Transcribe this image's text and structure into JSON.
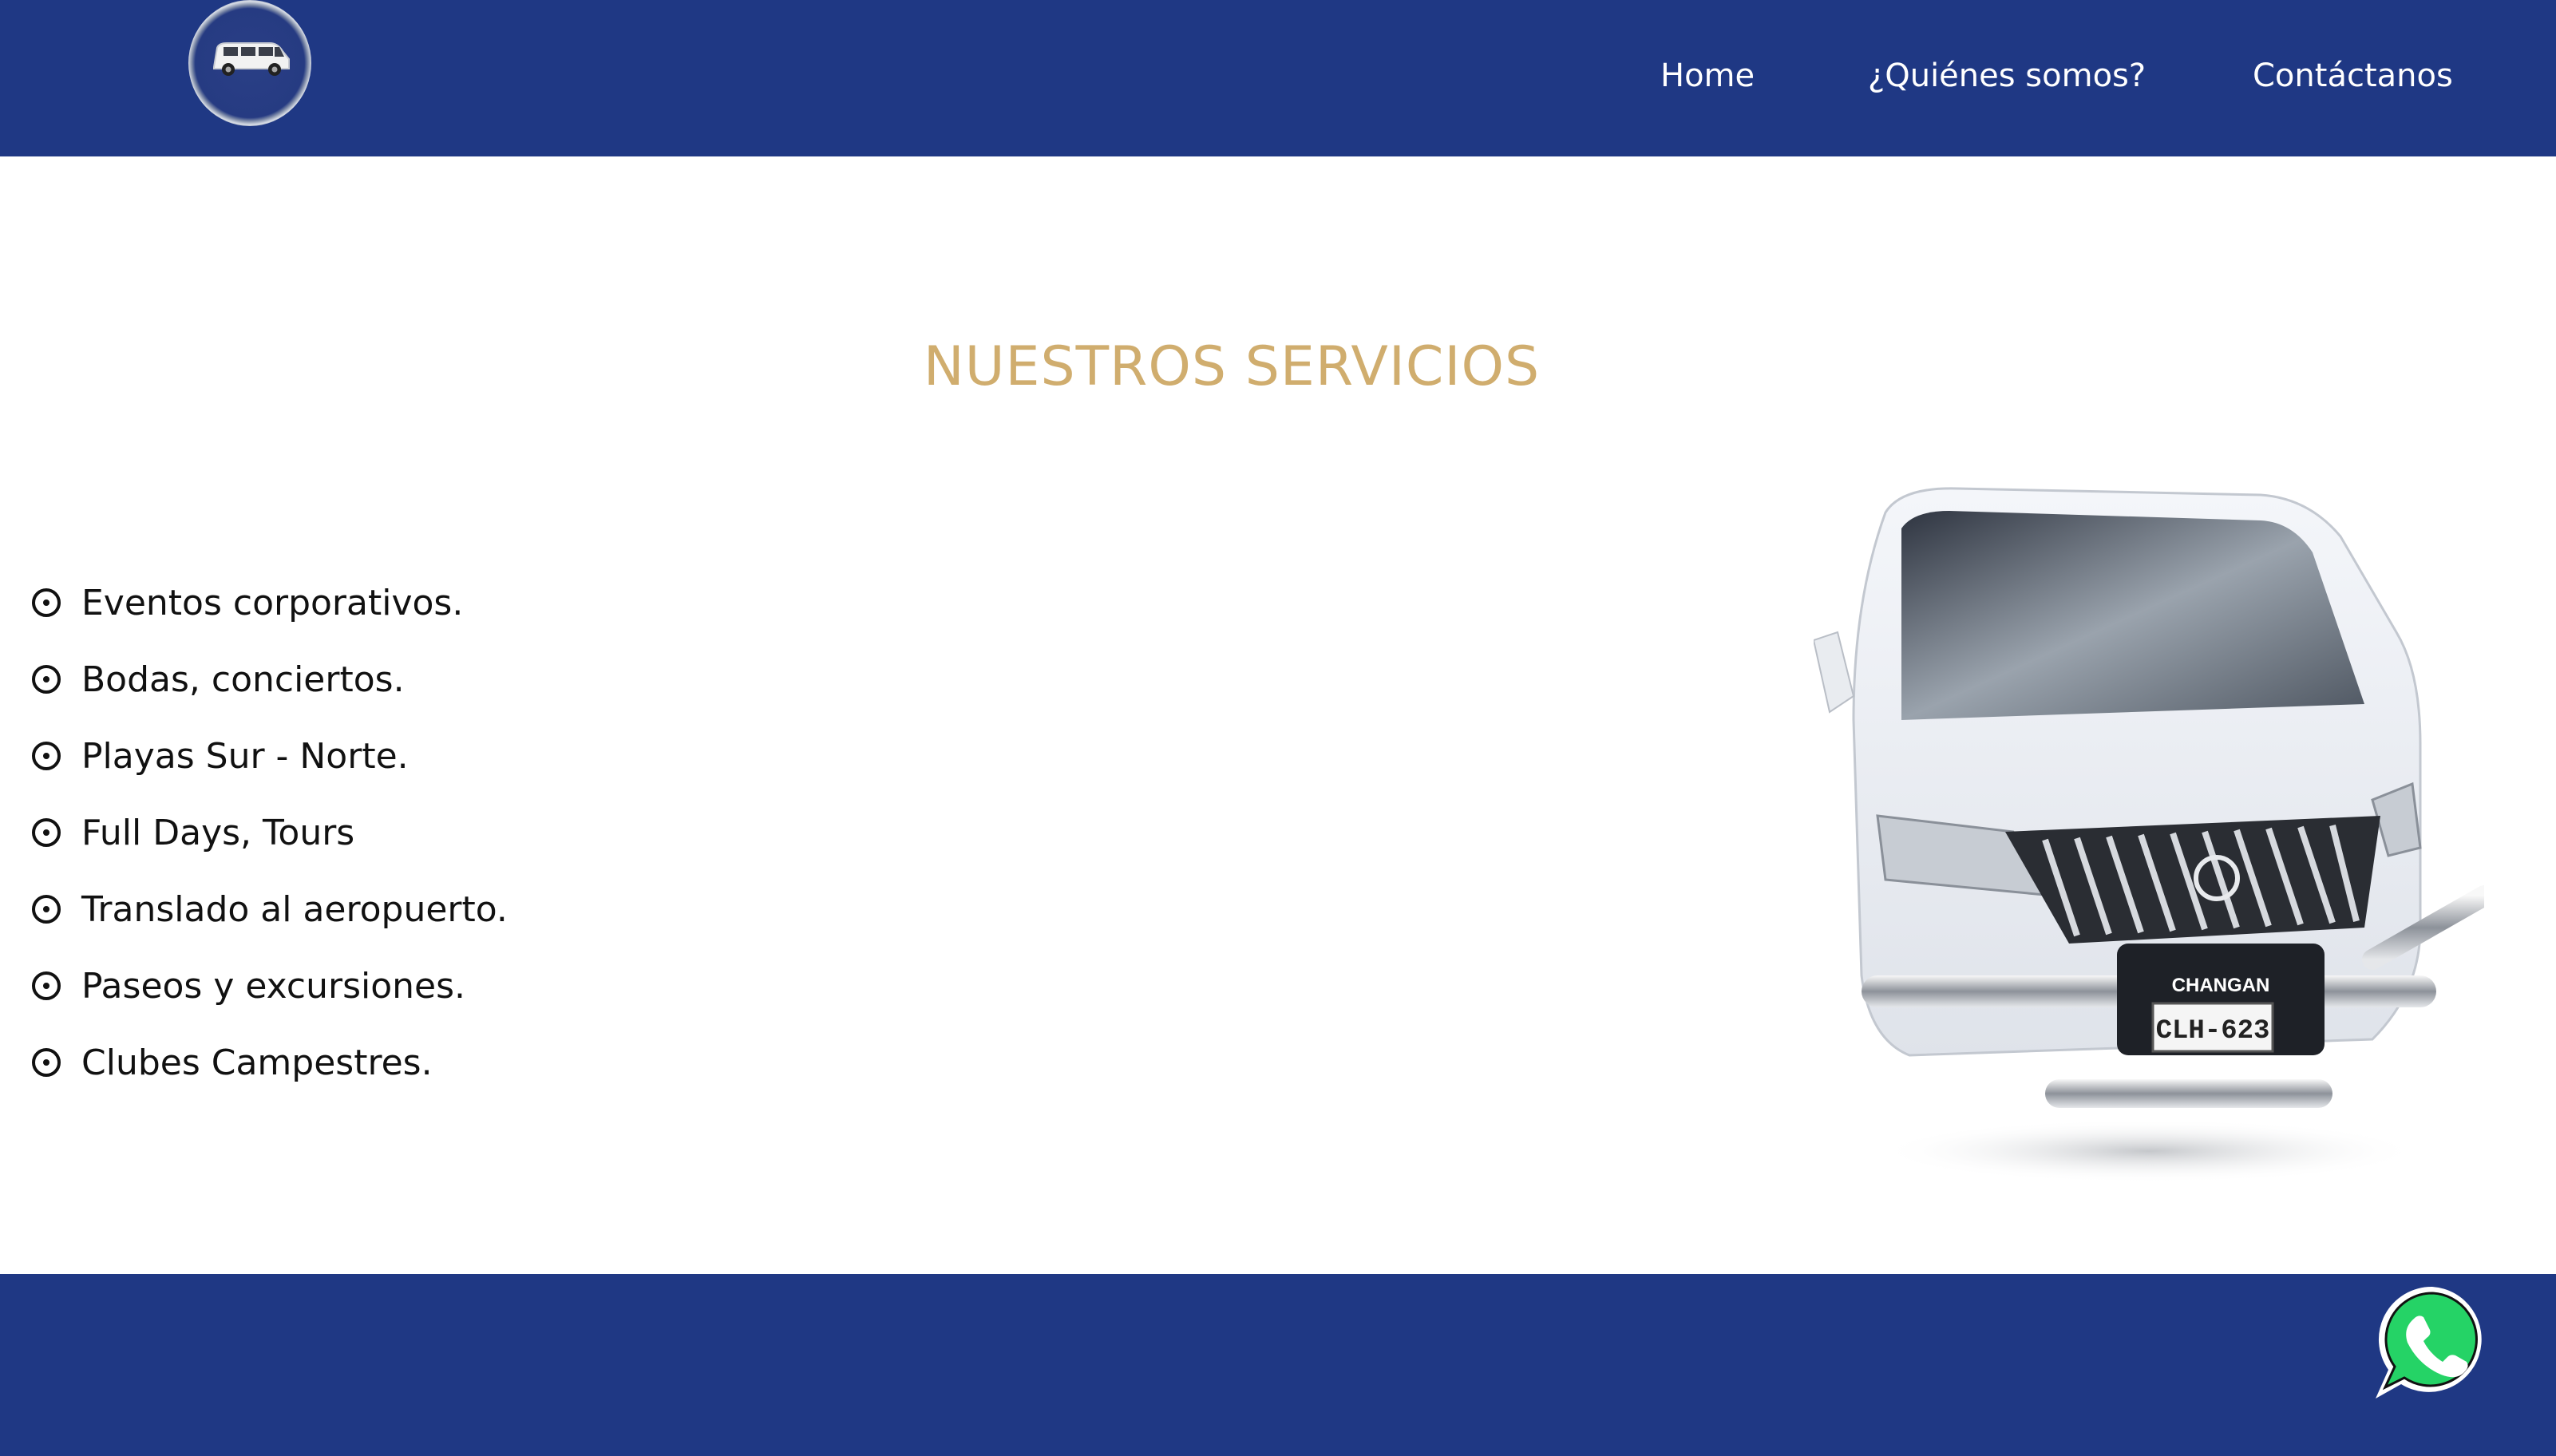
{
  "header": {
    "logo_icon": "van-logo-icon",
    "nav": [
      {
        "label": "Home"
      },
      {
        "label": "¿Quiénes somos?"
      },
      {
        "label": "Contáctanos"
      }
    ]
  },
  "main": {
    "title": "NUESTROS SERVICIOS",
    "services": [
      {
        "label": "Eventos corporativos."
      },
      {
        "label": "Bodas, conciertos."
      },
      {
        "label": "Playas Sur - Norte."
      },
      {
        "label": "Full Days, Tours"
      },
      {
        "label": "Translado al aeropuerto."
      },
      {
        "label": "Paseos y excursiones."
      },
      {
        "label": "Clubes Campestres."
      }
    ],
    "bullet_icon": "circle-dot-icon",
    "van_plate_brand": "CHANGAN",
    "van_plate_number": "CLH-623"
  },
  "footer": {
    "whatsapp_icon": "whatsapp-icon"
  },
  "colors": {
    "brand_blue": "#1f3884",
    "title_gold": "#d0ad6e",
    "whatsapp_green": "#25d366"
  }
}
